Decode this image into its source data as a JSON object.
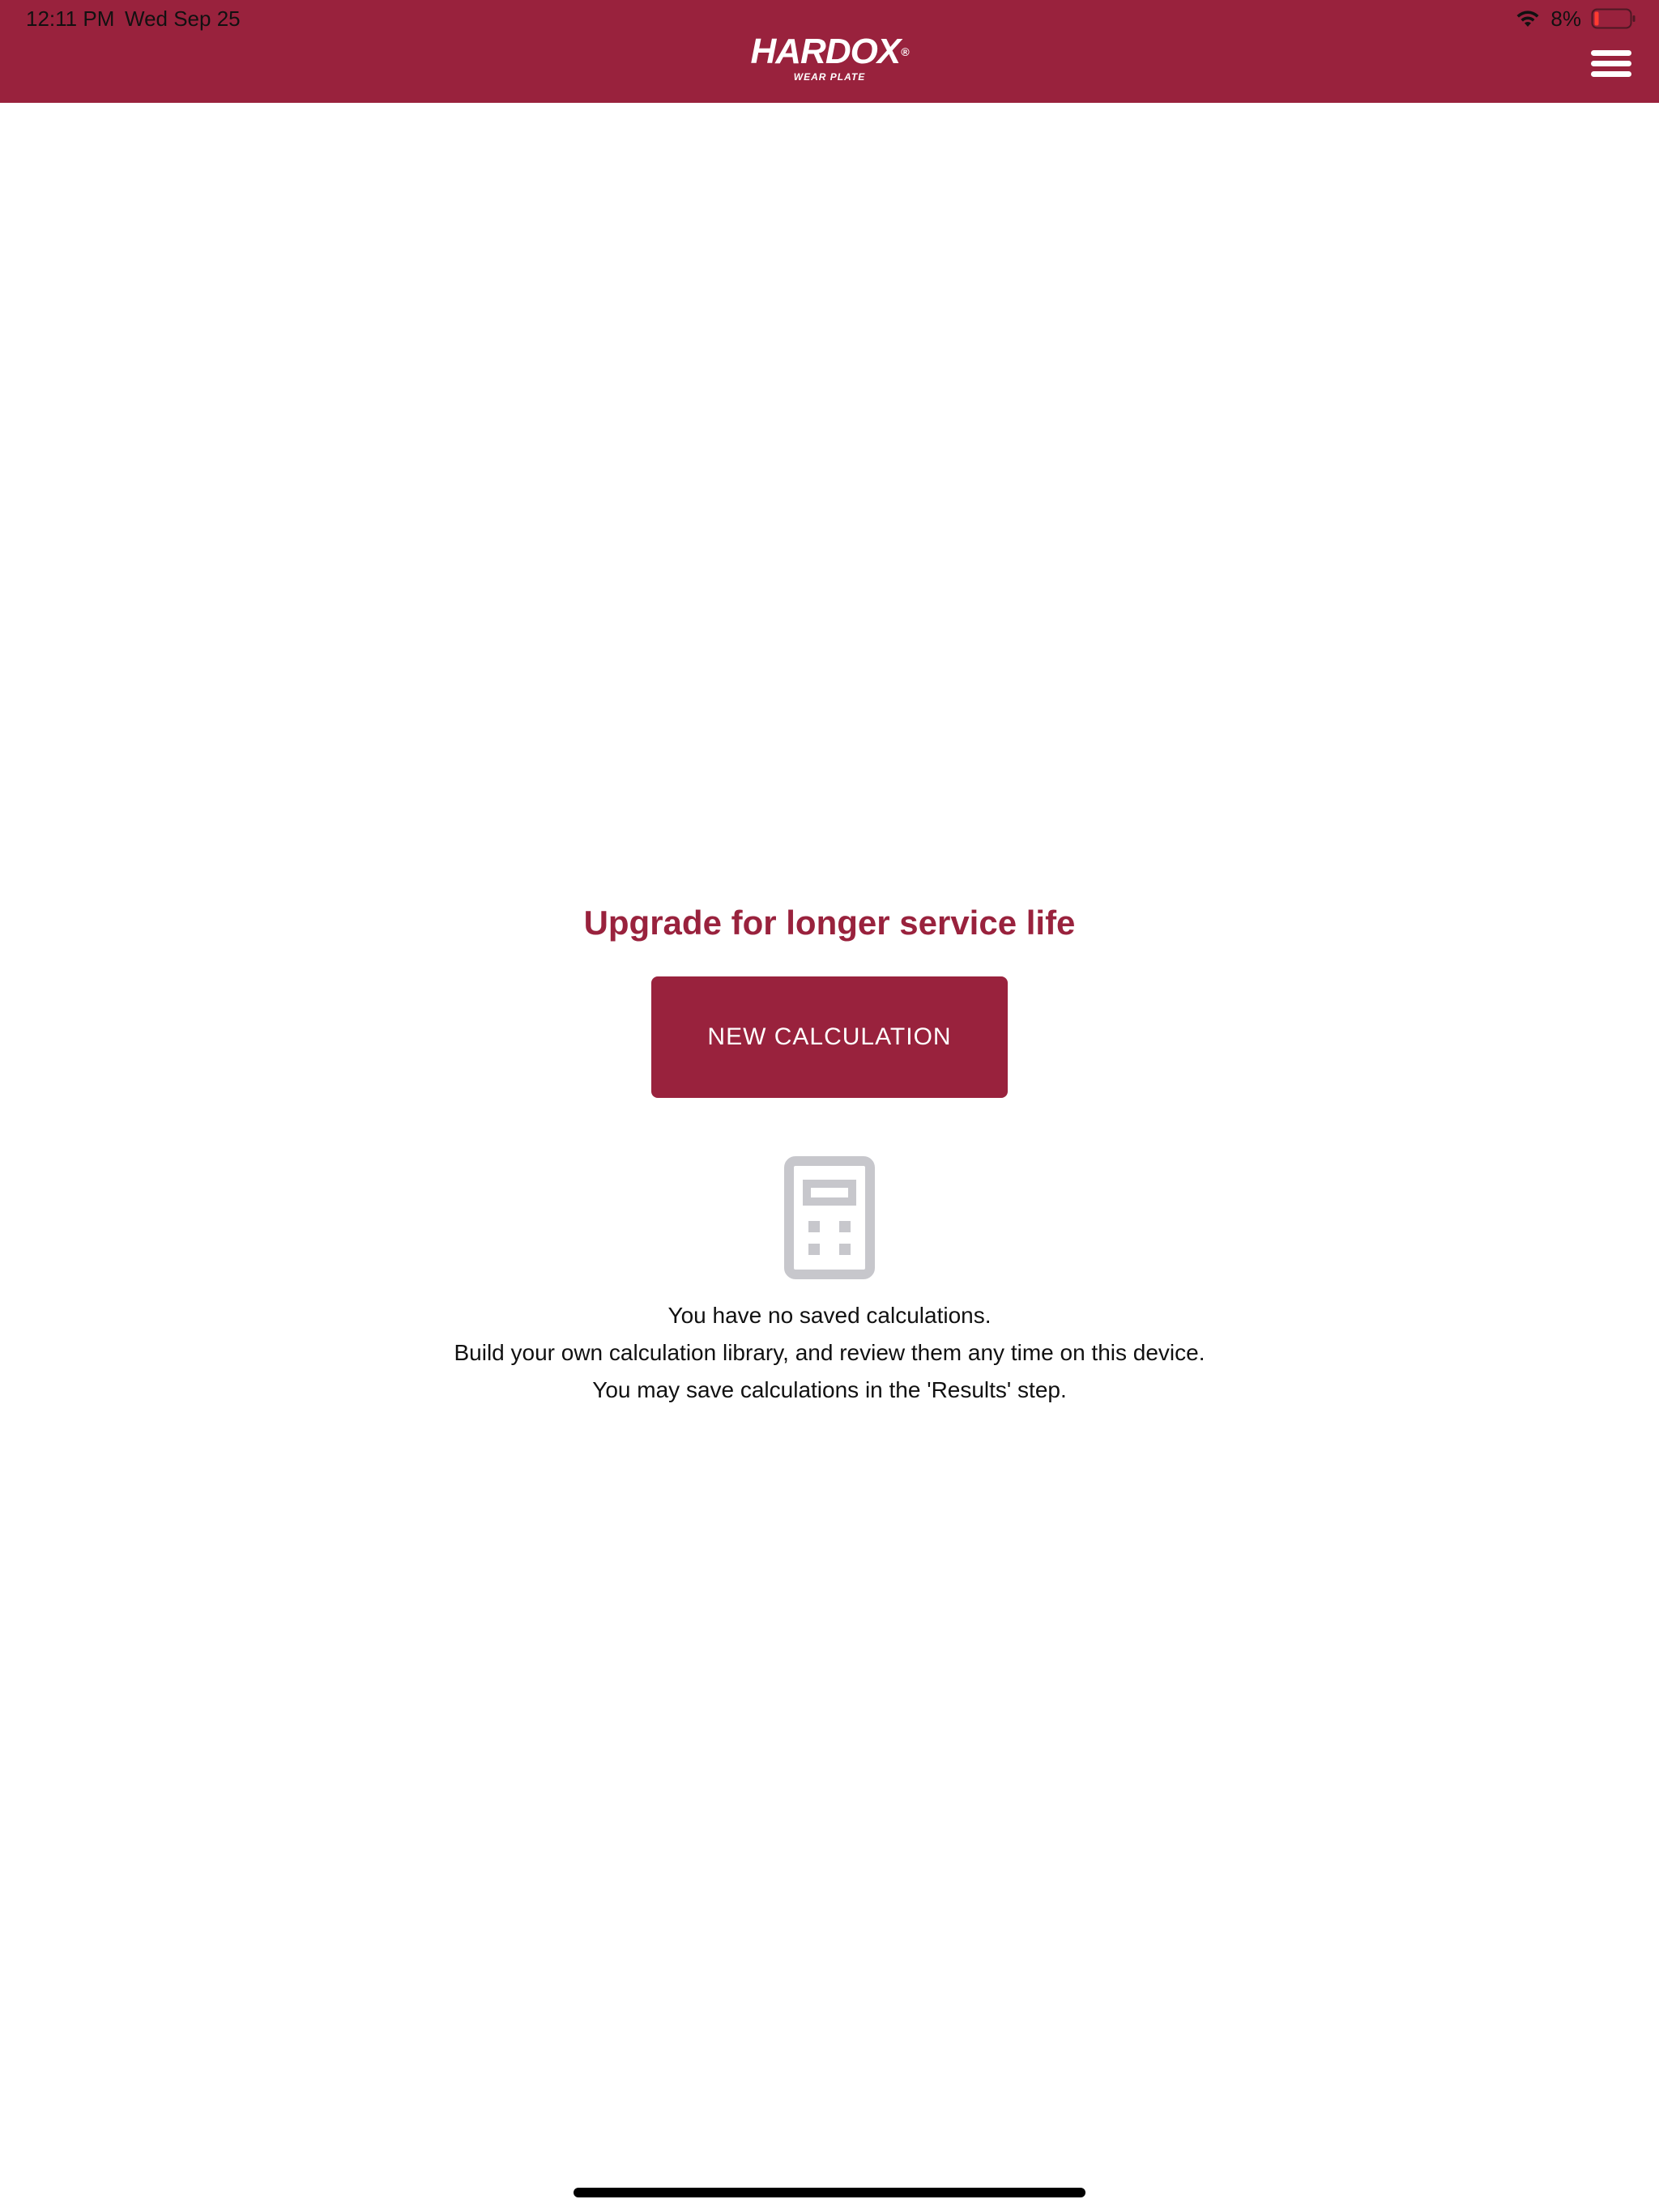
{
  "status_bar": {
    "time": "12:11 PM",
    "date": "Wed Sep 25",
    "battery_percent": "8%"
  },
  "header": {
    "logo_main": "HARDOX",
    "logo_registered": "®",
    "logo_sub": "WEAR PLATE",
    "menu_icon": "hamburger-menu-icon"
  },
  "main": {
    "headline": "Upgrade for longer service life",
    "new_calculation_label": "NEW CALCULATION",
    "empty_icon": "calculator-icon",
    "message_lines": [
      "You have no saved calculations.",
      "Build your own calculation library, and review them any time on this device.",
      "You may save calculations in the 'Results' step."
    ]
  },
  "colors": {
    "brand": "#99223d",
    "icon_gray": "#c7c7cc",
    "text": "#111111"
  }
}
